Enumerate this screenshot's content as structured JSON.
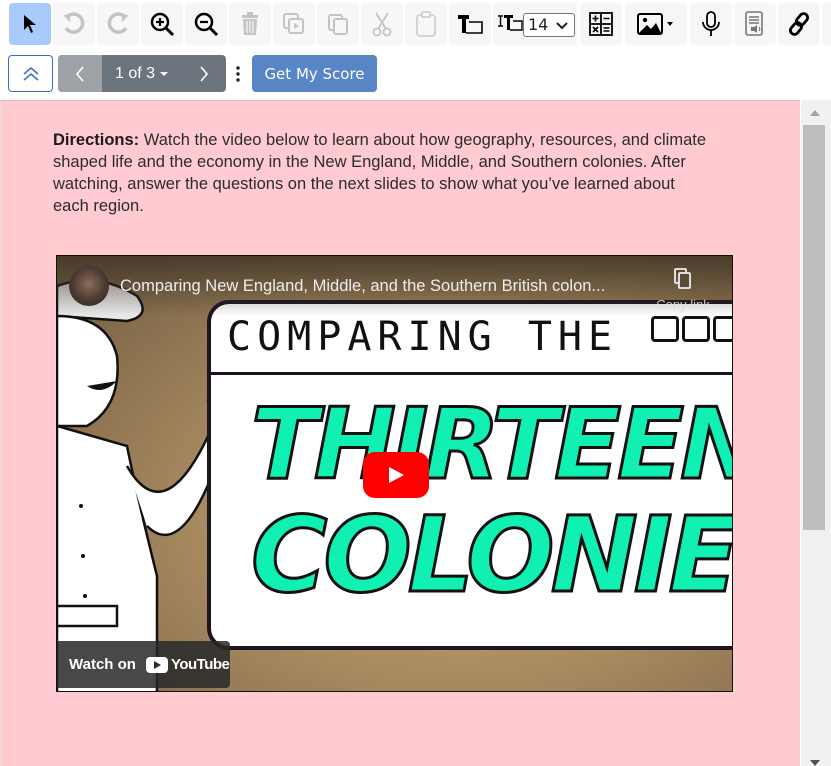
{
  "toolbar": {
    "buttons": [
      {
        "name": "select-tool",
        "icon": "pointer-icon",
        "state": "active"
      },
      {
        "name": "undo",
        "icon": "undo-icon",
        "state": "disabled"
      },
      {
        "name": "redo",
        "icon": "redo-icon",
        "state": "disabled"
      },
      {
        "name": "zoom-in",
        "icon": "zoom-in-icon",
        "state": "enabled"
      },
      {
        "name": "zoom-out",
        "icon": "zoom-out-icon",
        "state": "enabled"
      },
      {
        "name": "delete",
        "icon": "trash-icon",
        "state": "disabled"
      },
      {
        "name": "duplicate",
        "icon": "duplicate-icon",
        "state": "disabled"
      },
      {
        "name": "copy",
        "icon": "copy-icon",
        "state": "disabled"
      },
      {
        "name": "cut",
        "icon": "scissors-icon",
        "state": "disabled"
      },
      {
        "name": "paste",
        "icon": "clipboard-icon",
        "state": "disabled"
      },
      {
        "name": "text-box",
        "icon": "text-box-icon",
        "state": "enabled"
      },
      {
        "name": "equation",
        "icon": "math-operators-icon",
        "state": "enabled"
      },
      {
        "name": "insert-image",
        "icon": "image-icon",
        "state": "enabled"
      },
      {
        "name": "record-audio",
        "icon": "microphone-icon",
        "state": "enabled"
      },
      {
        "name": "text-to-speech",
        "icon": "document-speaker-icon",
        "state": "disabled"
      },
      {
        "name": "insert-link",
        "icon": "link-icon",
        "state": "enabled"
      }
    ],
    "font_size": {
      "icon": "font-size-text-icon",
      "value": "14"
    }
  },
  "navbar": {
    "collapse_icon": "double-chevron-up-icon",
    "pager": {
      "label": "1 of 3",
      "prev_icon": "chevron-left-icon",
      "next_icon": "chevron-right-icon",
      "dropdown_icon": "caret-down-icon"
    },
    "more_icon": "vertical-ellipsis-icon",
    "score_button": "Get My Score"
  },
  "content": {
    "directions_label": "Directions:",
    "directions_text": " Watch the video below to learn about how geography, resources, and climate shaped life and the economy in the New England, Middle, and Southern colonies. After watching, answer the questions on the next slides to show what you’ve learned about each region.",
    "background_color": "#ffcbd0",
    "video": {
      "title": "Comparing New England, Middle, and the Southern British colon...",
      "copy_link_label": "Copy link",
      "thumbnail_heading": "COMPARING THE",
      "thumbnail_line1": "THIRTEEN",
      "thumbnail_line2": "COLONIES",
      "watch_on_label": "Watch on",
      "youtube_label": "YouTube",
      "play_color": "#ff0000"
    }
  },
  "colors": {
    "accent": "#5785c6",
    "active_tool": "#a9cbfb",
    "pager_bg": "#6c757d"
  }
}
